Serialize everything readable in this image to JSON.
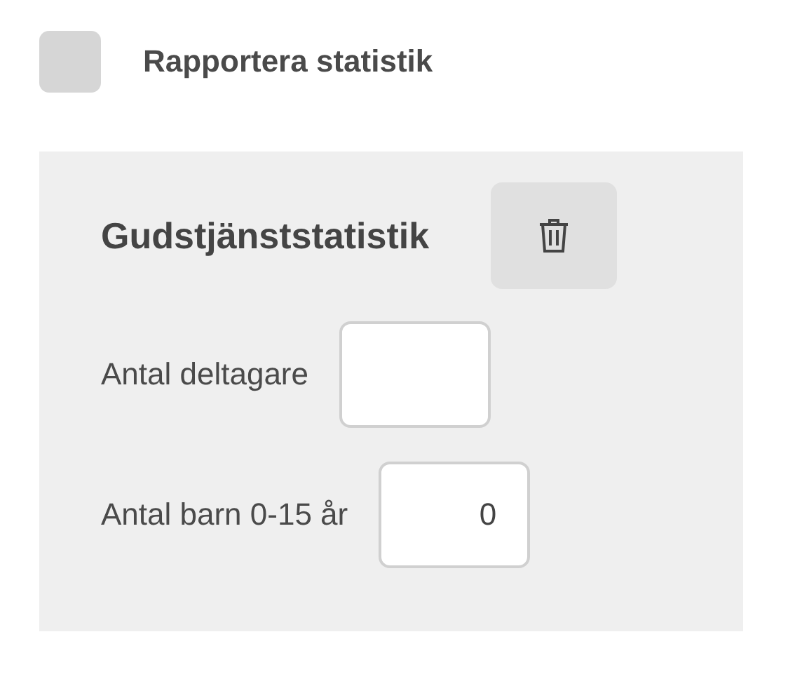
{
  "report_checkbox": {
    "label": "Rapportera statistik",
    "checked": false
  },
  "section": {
    "title": "Gudstjänststatistik",
    "fields": [
      {
        "label": "Antal deltagare"
      },
      {
        "label": "Antal barn 0-15 år",
        "value": "0"
      }
    ]
  }
}
